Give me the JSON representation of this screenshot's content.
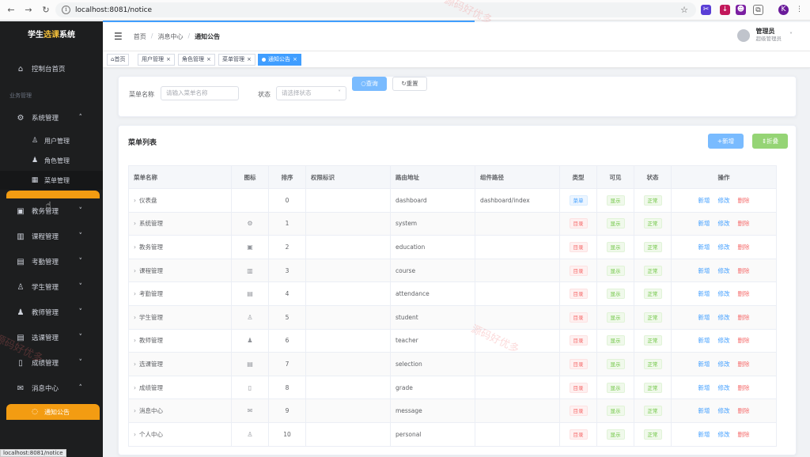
{
  "browser": {
    "url": "localhost:8081/notice",
    "status_url": "localhost:8081/notice"
  },
  "sidebar": {
    "title_part1": "学生",
    "title_part2": "选课",
    "title_part3": "系统",
    "home": "控制台首页",
    "group_title": "业务管理",
    "system": "系统管理",
    "sub_user": "用户管理",
    "sub_role": "角色管理",
    "sub_menu": "菜单管理",
    "education": "教务管理",
    "course": "课程管理",
    "attendance": "考勤管理",
    "student": "学生管理",
    "teacher": "教师管理",
    "selection": "选课管理",
    "grade": "成绩管理",
    "message": "消息中心",
    "sub_notice": "通知公告"
  },
  "header": {
    "breadcrumb": [
      "首页",
      "消息中心",
      "通知公告"
    ],
    "user_name": "管理员",
    "user_role": "超级管理员"
  },
  "tags": {
    "home": "首页",
    "user": "用户管理",
    "role": "角色管理",
    "menu": "菜单管理",
    "notice": "通知公告"
  },
  "search": {
    "name_label": "菜单名称",
    "name_placeholder": "请输入菜单名称",
    "status_label": "状态",
    "status_placeholder": "请选择状态",
    "query": "查询",
    "reset": "重置"
  },
  "table": {
    "title": "菜单列表",
    "add": "+新增",
    "collapse": "⇕折叠",
    "headers": [
      "菜单名称",
      "图标",
      "排序",
      "权限标识",
      "路由地址",
      "组件路径",
      "类型",
      "可见",
      "状态",
      "操作"
    ],
    "ops": {
      "add": "新增",
      "edit": "修改",
      "delete": "删除"
    },
    "rows": [
      {
        "name": "仪表盘",
        "icon": "",
        "order": "0",
        "perm": "",
        "route": "dashboard",
        "component": "dashboard/index",
        "type": "菜单",
        "visible": "显示",
        "status": "正常"
      },
      {
        "name": "系统管理",
        "icon": "⚙",
        "order": "1",
        "perm": "",
        "route": "system",
        "component": "",
        "type": "目录",
        "visible": "显示",
        "status": "正常"
      },
      {
        "name": "教务管理",
        "icon": "▣",
        "order": "2",
        "perm": "",
        "route": "education",
        "component": "",
        "type": "目录",
        "visible": "显示",
        "status": "正常"
      },
      {
        "name": "课程管理",
        "icon": "▥",
        "order": "3",
        "perm": "",
        "route": "course",
        "component": "",
        "type": "目录",
        "visible": "显示",
        "status": "正常"
      },
      {
        "name": "考勤管理",
        "icon": "▤",
        "order": "4",
        "perm": "",
        "route": "attendance",
        "component": "",
        "type": "目录",
        "visible": "显示",
        "status": "正常"
      },
      {
        "name": "学生管理",
        "icon": "♙",
        "order": "5",
        "perm": "",
        "route": "student",
        "component": "",
        "type": "目录",
        "visible": "显示",
        "status": "正常"
      },
      {
        "name": "教师管理",
        "icon": "♟",
        "order": "6",
        "perm": "",
        "route": "teacher",
        "component": "",
        "type": "目录",
        "visible": "显示",
        "status": "正常"
      },
      {
        "name": "选课管理",
        "icon": "▤",
        "order": "7",
        "perm": "",
        "route": "selection",
        "component": "",
        "type": "目录",
        "visible": "显示",
        "status": "正常"
      },
      {
        "name": "成绩管理",
        "icon": "▯",
        "order": "8",
        "perm": "",
        "route": "grade",
        "component": "",
        "type": "目录",
        "visible": "显示",
        "status": "正常"
      },
      {
        "name": "消息中心",
        "icon": "✉",
        "order": "9",
        "perm": "",
        "route": "message",
        "component": "",
        "type": "目录",
        "visible": "显示",
        "status": "正常"
      },
      {
        "name": "个人中心",
        "icon": "♙",
        "order": "10",
        "perm": "",
        "route": "personal",
        "component": "",
        "type": "目录",
        "visible": "显示",
        "status": "正常"
      }
    ]
  },
  "watermark": "源码好优多"
}
